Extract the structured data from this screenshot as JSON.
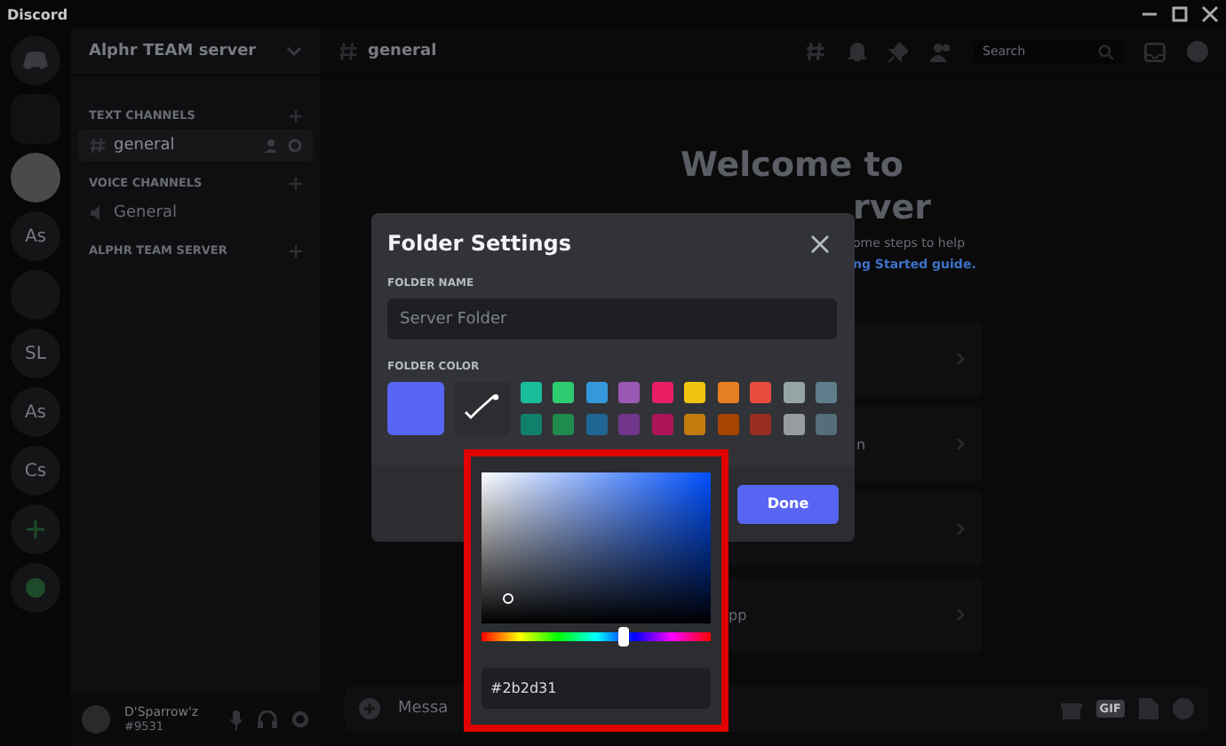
{
  "window": {
    "title": "Discord"
  },
  "servers": [
    {
      "kind": "logo"
    },
    {
      "kind": "folder"
    },
    {
      "kind": "avatar"
    },
    {
      "kind": "initials",
      "label": "As"
    },
    {
      "kind": "blank"
    },
    {
      "kind": "initials",
      "label": "SL"
    },
    {
      "kind": "initials",
      "label": "As"
    },
    {
      "kind": "initials",
      "label": "Cs"
    },
    {
      "kind": "add"
    },
    {
      "kind": "explore"
    }
  ],
  "channel_sidebar": {
    "server_name": "Alphr TEAM server",
    "categories": [
      {
        "name": "TEXT CHANNELS",
        "channels": [
          {
            "name": "general",
            "kind": "text",
            "selected": true
          }
        ]
      },
      {
        "name": "VOICE CHANNELS",
        "channels": [
          {
            "name": "General",
            "kind": "voice",
            "selected": false
          }
        ]
      },
      {
        "name": "ALPHR TEAM SERVER"
      }
    ]
  },
  "user": {
    "name": "D'Sparrow'z",
    "tag": "#9531"
  },
  "header": {
    "channel": "general",
    "search_placeholder": "Search"
  },
  "welcome": {
    "title_line_1": "Welcome to",
    "title_line_2": "rver",
    "text": "ome steps to help",
    "link": "ng Started guide."
  },
  "cards": [
    {
      "kind": "blank"
    },
    {
      "kind": "tail",
      "label": "n"
    },
    {
      "kind": "blank"
    },
    {
      "kind": "plain",
      "label": "pp"
    }
  ],
  "composer": {
    "placeholder": "Messa",
    "gif_label": "GIF"
  },
  "modal": {
    "title": "Folder Settings",
    "name_label": "FOLDER NAME",
    "name_placeholder": "Server Folder",
    "color_label": "FOLDER COLOR",
    "custom_swatch": {
      "color": "#5865f2"
    },
    "swatches": [
      {
        "color": "#1abc9c"
      },
      {
        "color": "#2ecc71"
      },
      {
        "color": "#3498db"
      },
      {
        "color": "#9b59b6"
      },
      {
        "color": "#e91e63"
      },
      {
        "color": "#f1c40f"
      },
      {
        "color": "#e67e22"
      },
      {
        "color": "#e74c3c"
      },
      {
        "color": "#95a5a6"
      },
      {
        "color": "#607d8b"
      },
      {
        "color": "#11806a"
      },
      {
        "color": "#1f8b4c"
      },
      {
        "color": "#206694"
      },
      {
        "color": "#71368a"
      },
      {
        "color": "#ad1457"
      },
      {
        "color": "#c27c0e"
      },
      {
        "color": "#a84300"
      },
      {
        "color": "#992d22"
      },
      {
        "color": "#979c9f"
      },
      {
        "color": "#546e7a"
      }
    ],
    "done_label": "Done"
  },
  "color_picker": {
    "hue": {
      "level": 0.62
    },
    "hex_value": "#2b2d31"
  }
}
